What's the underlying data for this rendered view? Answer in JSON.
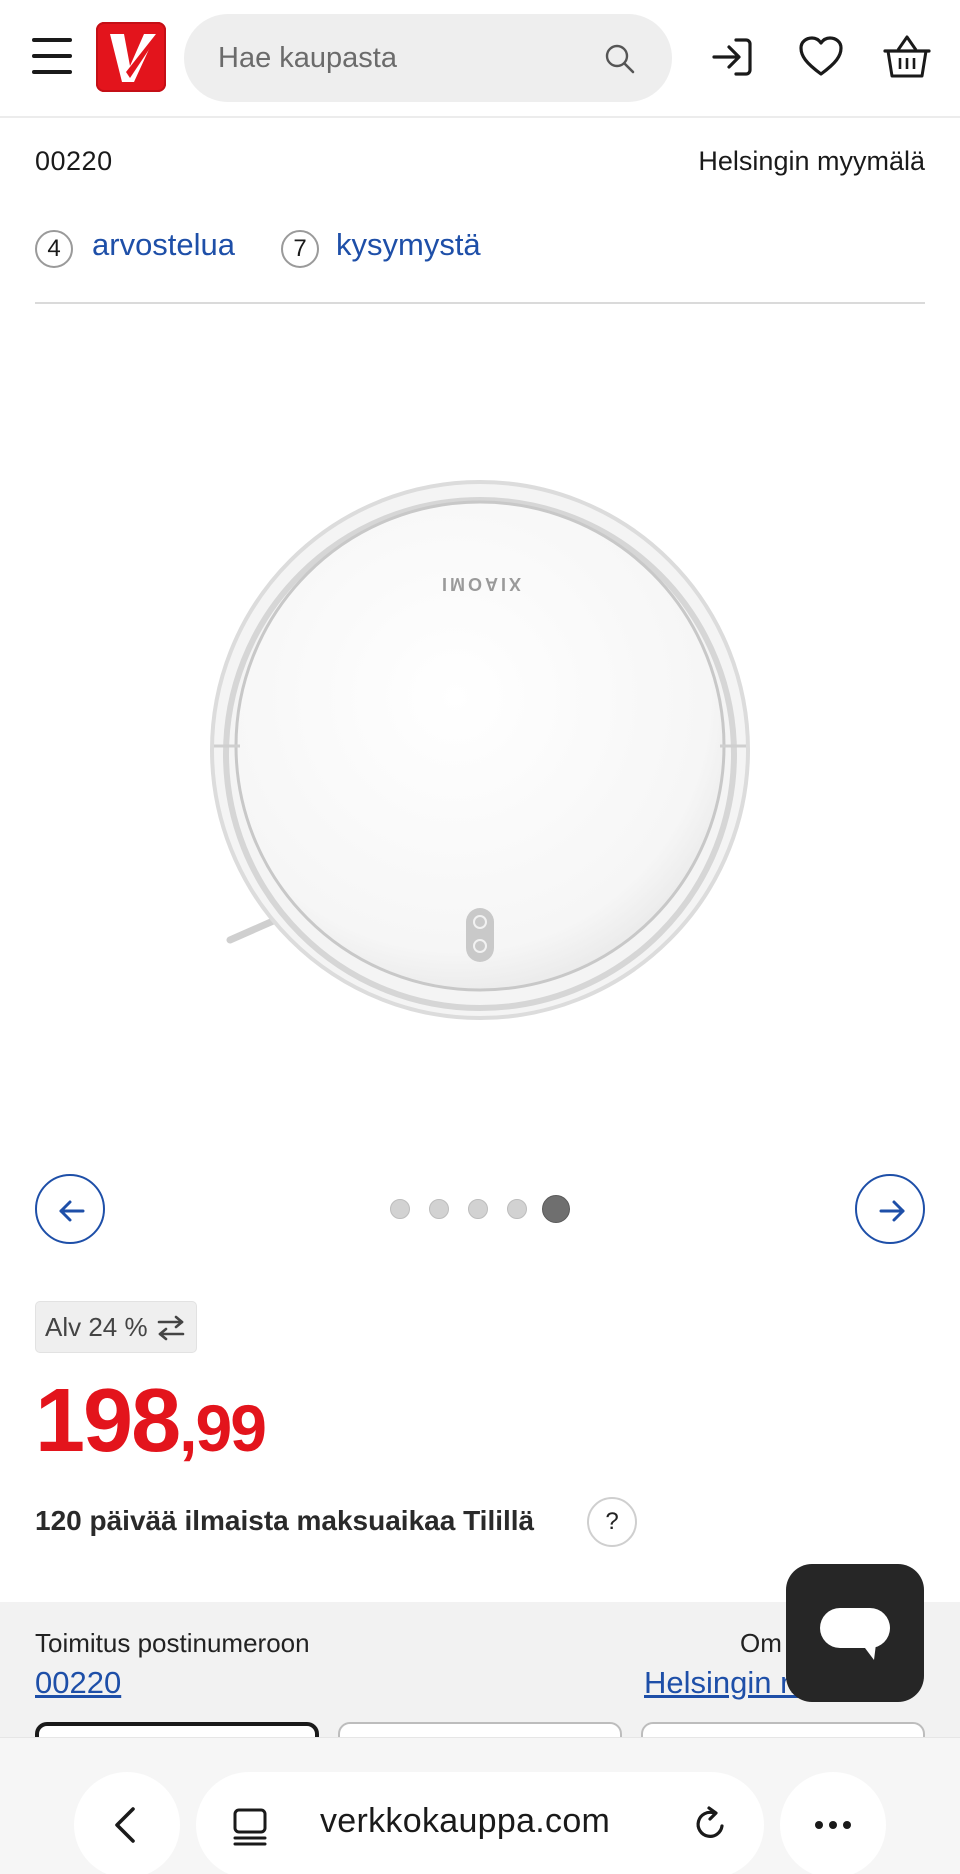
{
  "header": {
    "search_placeholder": "Hae kaupasta"
  },
  "location": {
    "postal_code": "00220",
    "store": "Helsingin myymälä"
  },
  "reviews": {
    "review_count": "4",
    "review_label": "arvostelua",
    "question_count": "7",
    "question_label": "kysymystä"
  },
  "product_image": {
    "brand_text": "XIAOMI"
  },
  "carousel": {
    "total": 5,
    "active_index": 4
  },
  "price": {
    "vat_label": "Alv 24 %",
    "integer": "198",
    "decimals": ",99",
    "payment_text": "120 päivää ilmaista maksuaikaa Tilillä",
    "help_symbol": "?"
  },
  "delivery": {
    "delivery_label": "Toimitus postinumeroon",
    "delivery_postal": "00220",
    "pickup_label": "Om",
    "pickup_store": "Helsingin myymälä"
  },
  "browser": {
    "url": "verkkokauppa.com"
  },
  "colors": {
    "brand_red": "#e3141c",
    "link_blue": "#1e4fa8"
  }
}
